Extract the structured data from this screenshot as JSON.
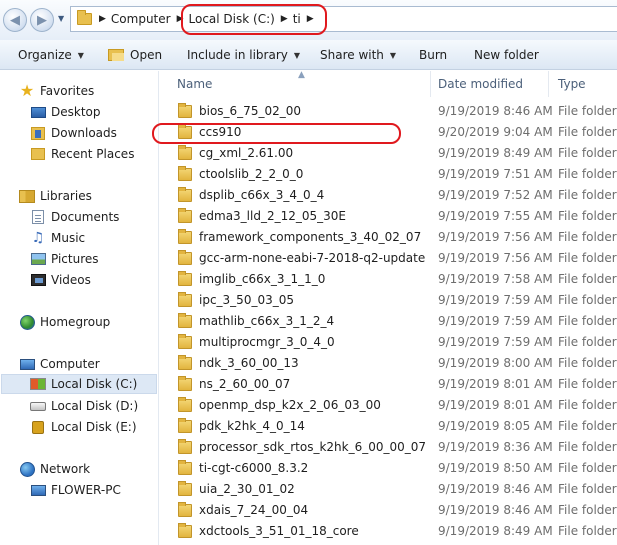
{
  "address": {
    "crumbs": [
      "Computer",
      "Local Disk (C:)",
      "ti"
    ]
  },
  "toolbar": {
    "organize": "Organize",
    "open": "Open",
    "include_in_library": "Include in library",
    "share_with": "Share with",
    "burn": "Burn",
    "new_folder": "New folder"
  },
  "navpane": {
    "favorites": "Favorites",
    "desktop": "Desktop",
    "downloads": "Downloads",
    "recent_places": "Recent Places",
    "libraries": "Libraries",
    "documents": "Documents",
    "music": "Music",
    "pictures": "Pictures",
    "videos": "Videos",
    "homegroup": "Homegroup",
    "computer": "Computer",
    "local_disk_c": "Local Disk (C:)",
    "local_disk_d": "Local Disk (D:)",
    "local_disk_e": "Local Disk (E:)",
    "network": "Network",
    "flower_pc": "FLOWER-PC"
  },
  "columns": {
    "name": "Name",
    "date_modified": "Date modified",
    "type": "Type"
  },
  "files": [
    {
      "name": "bios_6_75_02_00",
      "date": "9/19/2019 8:46 AM",
      "type": "File folder"
    },
    {
      "name": "ccs910",
      "date": "9/20/2019 9:04 AM",
      "type": "File folder"
    },
    {
      "name": "cg_xml_2.61.00",
      "date": "9/19/2019 8:49 AM",
      "type": "File folder"
    },
    {
      "name": "ctoolslib_2_2_0_0",
      "date": "9/19/2019 7:51 AM",
      "type": "File folder"
    },
    {
      "name": "dsplib_c66x_3_4_0_4",
      "date": "9/19/2019 7:52 AM",
      "type": "File folder"
    },
    {
      "name": "edma3_lld_2_12_05_30E",
      "date": "9/19/2019 7:55 AM",
      "type": "File folder"
    },
    {
      "name": "framework_components_3_40_02_07",
      "date": "9/19/2019 7:56 AM",
      "type": "File folder"
    },
    {
      "name": "gcc-arm-none-eabi-7-2018-q2-update",
      "date": "9/19/2019 7:56 AM",
      "type": "File folder"
    },
    {
      "name": "imglib_c66x_3_1_1_0",
      "date": "9/19/2019 7:58 AM",
      "type": "File folder"
    },
    {
      "name": "ipc_3_50_03_05",
      "date": "9/19/2019 7:59 AM",
      "type": "File folder"
    },
    {
      "name": "mathlib_c66x_3_1_2_4",
      "date": "9/19/2019 7:59 AM",
      "type": "File folder"
    },
    {
      "name": "multiprocmgr_3_0_4_0",
      "date": "9/19/2019 7:59 AM",
      "type": "File folder"
    },
    {
      "name": "ndk_3_60_00_13",
      "date": "9/19/2019 8:00 AM",
      "type": "File folder"
    },
    {
      "name": "ns_2_60_00_07",
      "date": "9/19/2019 8:01 AM",
      "type": "File folder"
    },
    {
      "name": "openmp_dsp_k2x_2_06_03_00",
      "date": "9/19/2019 8:01 AM",
      "type": "File folder"
    },
    {
      "name": "pdk_k2hk_4_0_14",
      "date": "9/19/2019 8:05 AM",
      "type": "File folder"
    },
    {
      "name": "processor_sdk_rtos_k2hk_6_00_00_07",
      "date": "9/19/2019 8:36 AM",
      "type": "File folder"
    },
    {
      "name": "ti-cgt-c6000_8.3.2",
      "date": "9/19/2019 8:50 AM",
      "type": "File folder"
    },
    {
      "name": "uia_2_30_01_02",
      "date": "9/19/2019 8:46 AM",
      "type": "File folder"
    },
    {
      "name": "xdais_7_24_00_04",
      "date": "9/19/2019 8:46 AM",
      "type": "File folder"
    },
    {
      "name": "xdctools_3_51_01_18_core",
      "date": "9/19/2019 8:49 AM",
      "type": "File folder"
    }
  ],
  "colors": {
    "highlight_ring": "#e0191e",
    "selected_nav": "#dde8f5",
    "header_text": "#4c607a"
  }
}
